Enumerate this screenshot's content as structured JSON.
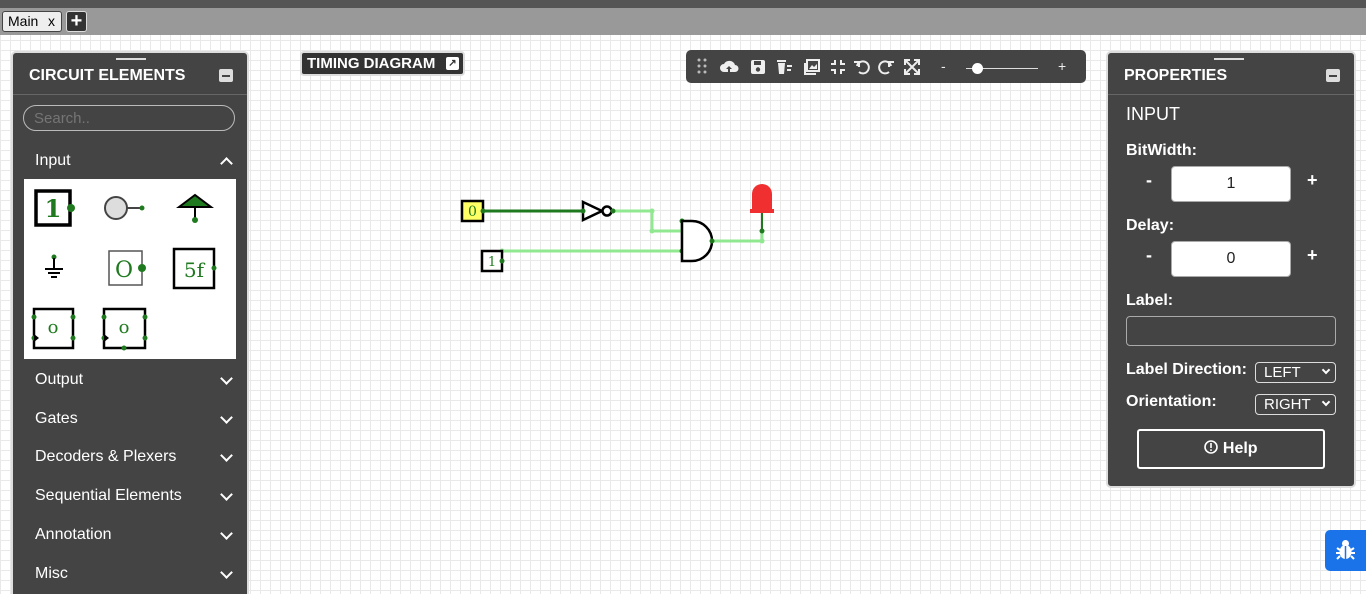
{
  "tabs": {
    "main_label": "Main",
    "close": "x",
    "add": "+"
  },
  "timing": {
    "label": "TIMING DIAGRAM",
    "icon": "external-link-icon"
  },
  "toolbar": {
    "icons": [
      "drag-handle-icon",
      "cloud-upload-icon",
      "save-icon",
      "delete-icon",
      "image-icon",
      "fit-icon",
      "undo-icon",
      "redo-icon",
      "fullscreen-icon"
    ],
    "zoom_minus": "-",
    "zoom_plus": "+",
    "zoom_level": 0.15
  },
  "left_panel": {
    "title": "CIRCUIT ELEMENTS",
    "search_placeholder": "Search..",
    "categories": [
      {
        "label": "Input",
        "expanded": true
      },
      {
        "label": "Output",
        "expanded": false
      },
      {
        "label": "Gates",
        "expanded": false
      },
      {
        "label": "Decoders & Plexers",
        "expanded": false
      },
      {
        "label": "Sequential Elements",
        "expanded": false
      },
      {
        "label": "Annotation",
        "expanded": false
      },
      {
        "label": "Misc",
        "expanded": false
      }
    ],
    "input_elements": [
      {
        "name": "input",
        "text": "1"
      },
      {
        "name": "button",
        "text": ""
      },
      {
        "name": "power",
        "text": ""
      },
      {
        "name": "ground",
        "text": ""
      },
      {
        "name": "constant-val",
        "text": "O"
      },
      {
        "name": "random",
        "text": "5f"
      },
      {
        "name": "counter",
        "text": "o"
      },
      {
        "name": "stepper",
        "text": "o"
      }
    ]
  },
  "properties": {
    "title": "PROPERTIES",
    "element_type": "INPUT",
    "bitwidth_label": "BitWidth:",
    "bitwidth_value": "1",
    "delay_label": "Delay:",
    "delay_value": "0",
    "minus": "-",
    "plus": "+",
    "label_label": "Label:",
    "label_value": "",
    "label_direction_label": "Label Direction:",
    "label_direction_value": "LEFT",
    "orientation_label": "Orientation:",
    "orientation_value": "RIGHT",
    "help_label": "Help"
  },
  "circuit": {
    "input_a": "0",
    "input_b": "1"
  },
  "colors": {
    "wire_active": "#1f7a1f",
    "wire_inactive": "#90e890",
    "led": "#f03030",
    "selected_input": "#ffff66",
    "panel": "#444444",
    "bug_button": "#1a73e8"
  }
}
